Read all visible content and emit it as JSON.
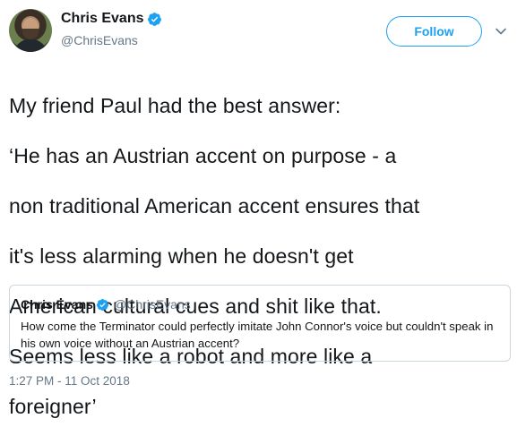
{
  "tweet": {
    "author": {
      "display_name": "Chris Evans",
      "handle": "@ChrisEvans",
      "verified_icon": "verified-badge-icon",
      "avatar": "profile-photo"
    },
    "follow_label": "Follow",
    "menu_icon": "chevron-down-icon",
    "lines": [
      "My friend Paul had the best answer:",
      "‘He has an Austrian accent on purpose - a",
      "non traditional American accent ensures that",
      "it's less alarming when he doesn't get",
      "American cultural cues and shit like that.",
      "Seems less like a robot and more like a",
      "foreigner’"
    ],
    "quoted": {
      "display_name": "Chris Evans",
      "handle": "@ChrisEvans",
      "text": "How come the Terminator could perfectly imitate John Connor's voice but couldn't speak in his own voice without an Austrian accent?"
    },
    "timestamp": "1:27 PM - 11 Oct 2018"
  },
  "colors": {
    "brand": "#1da1f2",
    "secondary_text": "#657786",
    "primary_text": "#14171a",
    "border": "#ccd6dd"
  }
}
